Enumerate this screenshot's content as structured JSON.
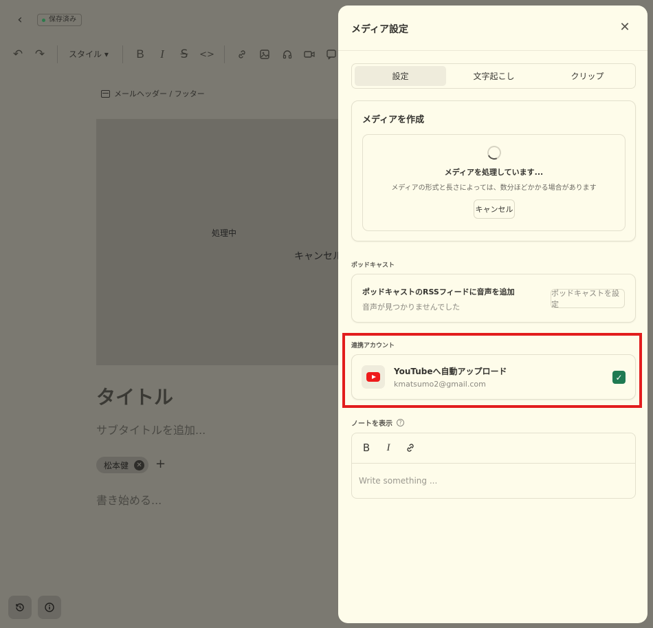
{
  "editor": {
    "saved_badge": "保存済み",
    "style_label": "スタイル ▾",
    "mail_header_footer": "メールヘッダー / フッター",
    "processing_label": "処理中",
    "cancel_label": "キャンセル",
    "title_placeholder": "タイトル",
    "subtitle_placeholder": "サブタイトルを追加...",
    "author_chip": "松本健",
    "body_placeholder": "書き始める..."
  },
  "panel": {
    "title": "メディア設定",
    "tabs": [
      {
        "label": "設定",
        "active": true
      },
      {
        "label": "文字起こし",
        "active": false
      },
      {
        "label": "クリップ",
        "active": false
      }
    ],
    "create_media": {
      "heading": "メディアを作成",
      "processing_title": "メディアを処理しています...",
      "processing_desc": "メディアの形式と長さによっては、数分ほどかかる場合があります",
      "cancel_button": "キャンセル"
    },
    "podcast": {
      "section_label": "ポッドキャスト",
      "title": "ポッドキャストのRSSフィードに音声を追加",
      "subtitle": "音声が見つかりませんでした",
      "button": "ポッドキャストを設定"
    },
    "linked_accounts": {
      "section_label": "連携アカウント",
      "youtube_title": "YouTubeへ自動アップロード",
      "youtube_email": "kmatsumo2@gmail.com",
      "checked": true
    },
    "note": {
      "label": "ノートを表示",
      "placeholder": "Write something ..."
    }
  },
  "colors": {
    "panel_bg": "#fefcea",
    "highlight": "#e21d1d",
    "check_green": "#1f7a52",
    "youtube_red": "#ee1b1b"
  }
}
